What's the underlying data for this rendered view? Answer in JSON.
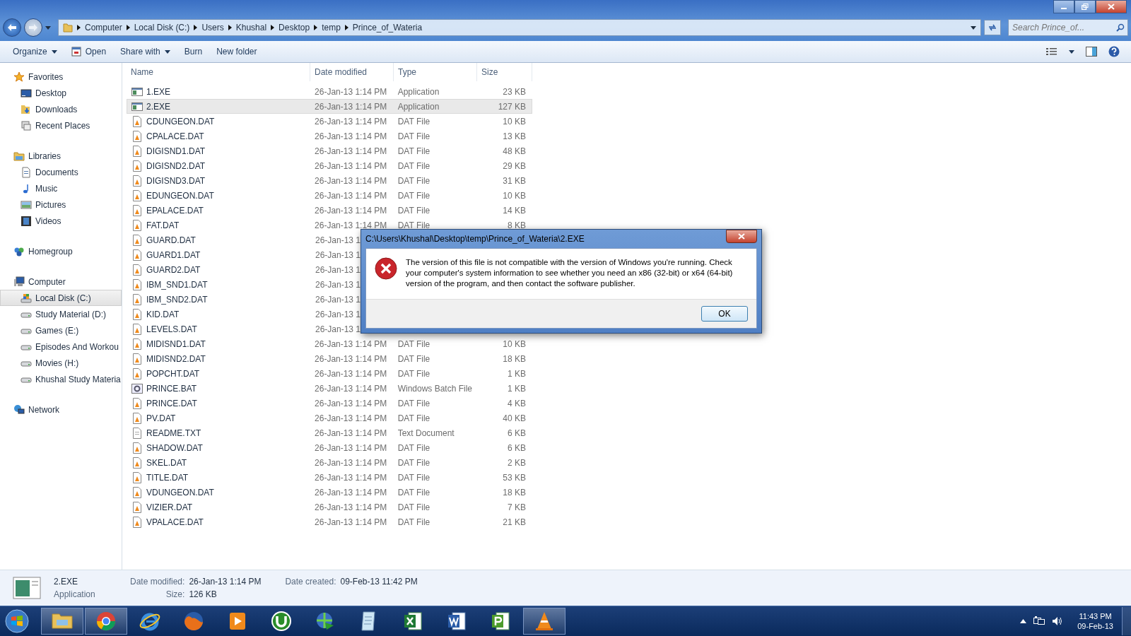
{
  "address_bar": {
    "crumbs": [
      "Computer",
      "Local Disk (C:)",
      "Users",
      "Khushal",
      "Desktop",
      "temp",
      "Prince_of_Wateria"
    ]
  },
  "search": {
    "placeholder": "Search Prince_of..."
  },
  "toolbar": {
    "buttons": [
      {
        "label": "Organize",
        "kind": "menu"
      },
      {
        "label": "Open",
        "kind": "open"
      },
      {
        "label": "Share with",
        "kind": "menu"
      },
      {
        "label": "Burn",
        "kind": "plain"
      },
      {
        "label": "New folder",
        "kind": "plain"
      }
    ]
  },
  "sidebar": {
    "groups": [
      {
        "label": "Favorites",
        "kind": "star",
        "selected": false,
        "children": [
          {
            "label": "Desktop",
            "kind": "desktop",
            "selected": false
          },
          {
            "label": "Downloads",
            "kind": "downloads",
            "selected": false
          },
          {
            "label": "Recent Places",
            "kind": "recent",
            "selected": false
          }
        ]
      },
      {
        "label": "Libraries",
        "kind": "folder",
        "selected": false,
        "children": [
          {
            "label": "Documents",
            "kind": "document",
            "selected": false
          },
          {
            "label": "Music",
            "kind": "music",
            "selected": false
          },
          {
            "label": "Pictures",
            "kind": "pictures",
            "selected": false
          },
          {
            "label": "Videos",
            "kind": "videos",
            "selected": false
          }
        ]
      },
      {
        "label": "Homegroup",
        "kind": "homegroup",
        "selected": false
      },
      {
        "label": "Computer",
        "kind": "computer",
        "selected": false,
        "children": [
          {
            "label": "Local Disk (C:)",
            "kind": "sysdrive",
            "selected": true
          },
          {
            "label": "Study Material (D:)",
            "kind": "drive",
            "selected": false
          },
          {
            "label": "Games (E:)",
            "kind": "drive",
            "selected": false
          },
          {
            "label": "Episodes And Workou",
            "kind": "drive",
            "selected": false
          },
          {
            "label": "Movies  (H:)",
            "kind": "drive",
            "selected": false
          },
          {
            "label": "Khushal Study Materia",
            "kind": "drive",
            "selected": false
          }
        ]
      },
      {
        "label": "Network",
        "kind": "network",
        "selected": false
      }
    ]
  },
  "table": {
    "columns": [
      "Name",
      "Date modified",
      "Type",
      "Size"
    ],
    "rows": [
      {
        "name": "1.EXE",
        "kind": "exe",
        "date": "26-Jan-13 1:14 PM",
        "type": "Application",
        "size": "23 KB",
        "selected": false
      },
      {
        "name": "2.EXE",
        "kind": "exe",
        "date": "26-Jan-13 1:14 PM",
        "type": "Application",
        "size": "127 KB",
        "selected": true
      },
      {
        "name": "CDUNGEON.DAT",
        "kind": "dat",
        "date": "26-Jan-13 1:14 PM",
        "type": "DAT File",
        "size": "10 KB",
        "selected": false
      },
      {
        "name": "CPALACE.DAT",
        "kind": "dat",
        "date": "26-Jan-13 1:14 PM",
        "type": "DAT File",
        "size": "13 KB",
        "selected": false
      },
      {
        "name": "DIGISND1.DAT",
        "kind": "dat",
        "date": "26-Jan-13 1:14 PM",
        "type": "DAT File",
        "size": "48 KB",
        "selected": false
      },
      {
        "name": "DIGISND2.DAT",
        "kind": "dat",
        "date": "26-Jan-13 1:14 PM",
        "type": "DAT File",
        "size": "29 KB",
        "selected": false
      },
      {
        "name": "DIGISND3.DAT",
        "kind": "dat",
        "date": "26-Jan-13 1:14 PM",
        "type": "DAT File",
        "size": "31 KB",
        "selected": false
      },
      {
        "name": "EDUNGEON.DAT",
        "kind": "dat",
        "date": "26-Jan-13 1:14 PM",
        "type": "DAT File",
        "size": "10 KB",
        "selected": false
      },
      {
        "name": "EPALACE.DAT",
        "kind": "dat",
        "date": "26-Jan-13 1:14 PM",
        "type": "DAT File",
        "size": "14 KB",
        "selected": false
      },
      {
        "name": "FAT.DAT",
        "kind": "dat",
        "date": "26-Jan-13 1:14 PM",
        "type": "DAT File",
        "size": "8 KB",
        "selected": false
      },
      {
        "name": "GUARD.DAT",
        "kind": "dat",
        "date": "26-Jan-13 1",
        "selected": false
      },
      {
        "name": "GUARD1.DAT",
        "kind": "dat",
        "date": "26-Jan-13 1",
        "selected": false
      },
      {
        "name": "GUARD2.DAT",
        "kind": "dat",
        "date": "26-Jan-13 1",
        "selected": false
      },
      {
        "name": "IBM_SND1.DAT",
        "kind": "dat",
        "date": "26-Jan-13 1",
        "selected": false
      },
      {
        "name": "IBM_SND2.DAT",
        "kind": "dat",
        "date": "26-Jan-13 1",
        "selected": false
      },
      {
        "name": "KID.DAT",
        "kind": "dat",
        "date": "26-Jan-13 1",
        "selected": false
      },
      {
        "name": "LEVELS.DAT",
        "kind": "dat",
        "date": "26-Jan-13 1",
        "selected": false
      },
      {
        "name": "MIDISND1.DAT",
        "kind": "dat",
        "date": "26-Jan-13 1:14 PM",
        "type": "DAT File",
        "size": "10 KB",
        "selected": false
      },
      {
        "name": "MIDISND2.DAT",
        "kind": "dat",
        "date": "26-Jan-13 1:14 PM",
        "type": "DAT File",
        "size": "18 KB",
        "selected": false
      },
      {
        "name": "POPCHT.DAT",
        "kind": "dat",
        "date": "26-Jan-13 1:14 PM",
        "type": "DAT File",
        "size": "1 KB",
        "selected": false
      },
      {
        "name": "PRINCE.BAT",
        "kind": "bat",
        "date": "26-Jan-13 1:14 PM",
        "type": "Windows Batch File",
        "size": "1 KB",
        "selected": false
      },
      {
        "name": "PRINCE.DAT",
        "kind": "dat",
        "date": "26-Jan-13 1:14 PM",
        "type": "DAT File",
        "size": "4 KB",
        "selected": false
      },
      {
        "name": "PV.DAT",
        "kind": "dat",
        "date": "26-Jan-13 1:14 PM",
        "type": "DAT File",
        "size": "40 KB",
        "selected": false
      },
      {
        "name": "README.TXT",
        "kind": "txt",
        "date": "26-Jan-13 1:14 PM",
        "type": "Text Document",
        "size": "6 KB",
        "selected": false
      },
      {
        "name": "SHADOW.DAT",
        "kind": "dat",
        "date": "26-Jan-13 1:14 PM",
        "type": "DAT File",
        "size": "6 KB",
        "selected": false
      },
      {
        "name": "SKEL.DAT",
        "kind": "dat",
        "date": "26-Jan-13 1:14 PM",
        "type": "DAT File",
        "size": "2 KB",
        "selected": false
      },
      {
        "name": "TITLE.DAT",
        "kind": "dat",
        "date": "26-Jan-13 1:14 PM",
        "type": "DAT File",
        "size": "53 KB",
        "selected": false
      },
      {
        "name": "VDUNGEON.DAT",
        "kind": "dat",
        "date": "26-Jan-13 1:14 PM",
        "type": "DAT File",
        "size": "18 KB",
        "selected": false
      },
      {
        "name": "VIZIER.DAT",
        "kind": "dat",
        "date": "26-Jan-13 1:14 PM",
        "type": "DAT File",
        "size": "7 KB",
        "selected": false
      },
      {
        "name": "VPALACE.DAT",
        "kind": "dat",
        "date": "26-Jan-13 1:14 PM",
        "type": "DAT File",
        "size": "21 KB",
        "selected": false
      }
    ]
  },
  "dialog": {
    "title": "C:\\Users\\Khushal\\Desktop\\temp\\Prince_of_Wateria\\2.EXE",
    "message": "The version of this file is not compatible with the version of Windows you're running. Check your computer's system information to see whether you need an x86 (32-bit) or x64 (64-bit) version of the program, and then contact the software publisher.",
    "button": "OK"
  },
  "details": {
    "name": "2.EXE",
    "type": "Application",
    "fields": [
      {
        "label": "Date modified:",
        "value": "26-Jan-13 1:14 PM"
      },
      {
        "label": "Size:",
        "value": "126 KB"
      },
      {
        "label": "Date created:",
        "value": "09-Feb-13 11:42 PM"
      }
    ]
  },
  "taskbar": {
    "apps": [
      {
        "kind": "explorer",
        "running": true
      },
      {
        "kind": "chrome",
        "running": true
      },
      {
        "kind": "ie",
        "running": false
      },
      {
        "kind": "firefox",
        "running": false
      },
      {
        "kind": "player",
        "running": false
      },
      {
        "kind": "torrent",
        "running": false
      },
      {
        "kind": "globe",
        "running": false
      },
      {
        "kind": "notepad",
        "running": false
      },
      {
        "kind": "excel",
        "running": false
      },
      {
        "kind": "word",
        "running": false
      },
      {
        "kind": "project",
        "running": false
      },
      {
        "kind": "vlc",
        "running": true
      }
    ],
    "time": "11:43 PM",
    "date": "09-Feb-13"
  }
}
